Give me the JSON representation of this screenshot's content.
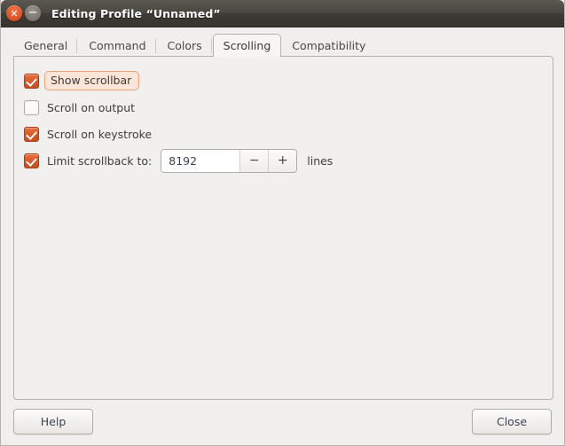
{
  "window": {
    "title": "Editing Profile “Unnamed”",
    "close_glyph": "✕",
    "minimize_glyph": "−"
  },
  "tabs": [
    {
      "label": "General",
      "active": false
    },
    {
      "label": "Command",
      "active": false
    },
    {
      "label": "Colors",
      "active": false
    },
    {
      "label": "Scrolling",
      "active": true
    },
    {
      "label": "Compatibility",
      "active": false
    }
  ],
  "scrolling": {
    "options": [
      {
        "label": "Show scrollbar",
        "checked": true,
        "focused": true
      },
      {
        "label": "Scroll on output",
        "checked": false,
        "focused": false
      },
      {
        "label": "Scroll on keystroke",
        "checked": true,
        "focused": false
      }
    ],
    "limit": {
      "label": "Limit scrollback to:",
      "checked": true,
      "value": "8192",
      "decrement_glyph": "−",
      "increment_glyph": "+",
      "units_label": "lines"
    }
  },
  "actions": {
    "help_label": "Help",
    "close_label": "Close"
  },
  "colors": {
    "titlebar_top": "#5b5751",
    "titlebar_bottom": "#37332f",
    "close_button": "#e2562a",
    "minimize_button": "#827c74",
    "checkbox_checked": "#d65a2a",
    "focus_ring_fill": "#fbe4d8",
    "focus_ring_border": "#e8a27a",
    "panel_background": "#f1f0ee",
    "window_background": "#f0efed",
    "text": "#3f3c38"
  }
}
